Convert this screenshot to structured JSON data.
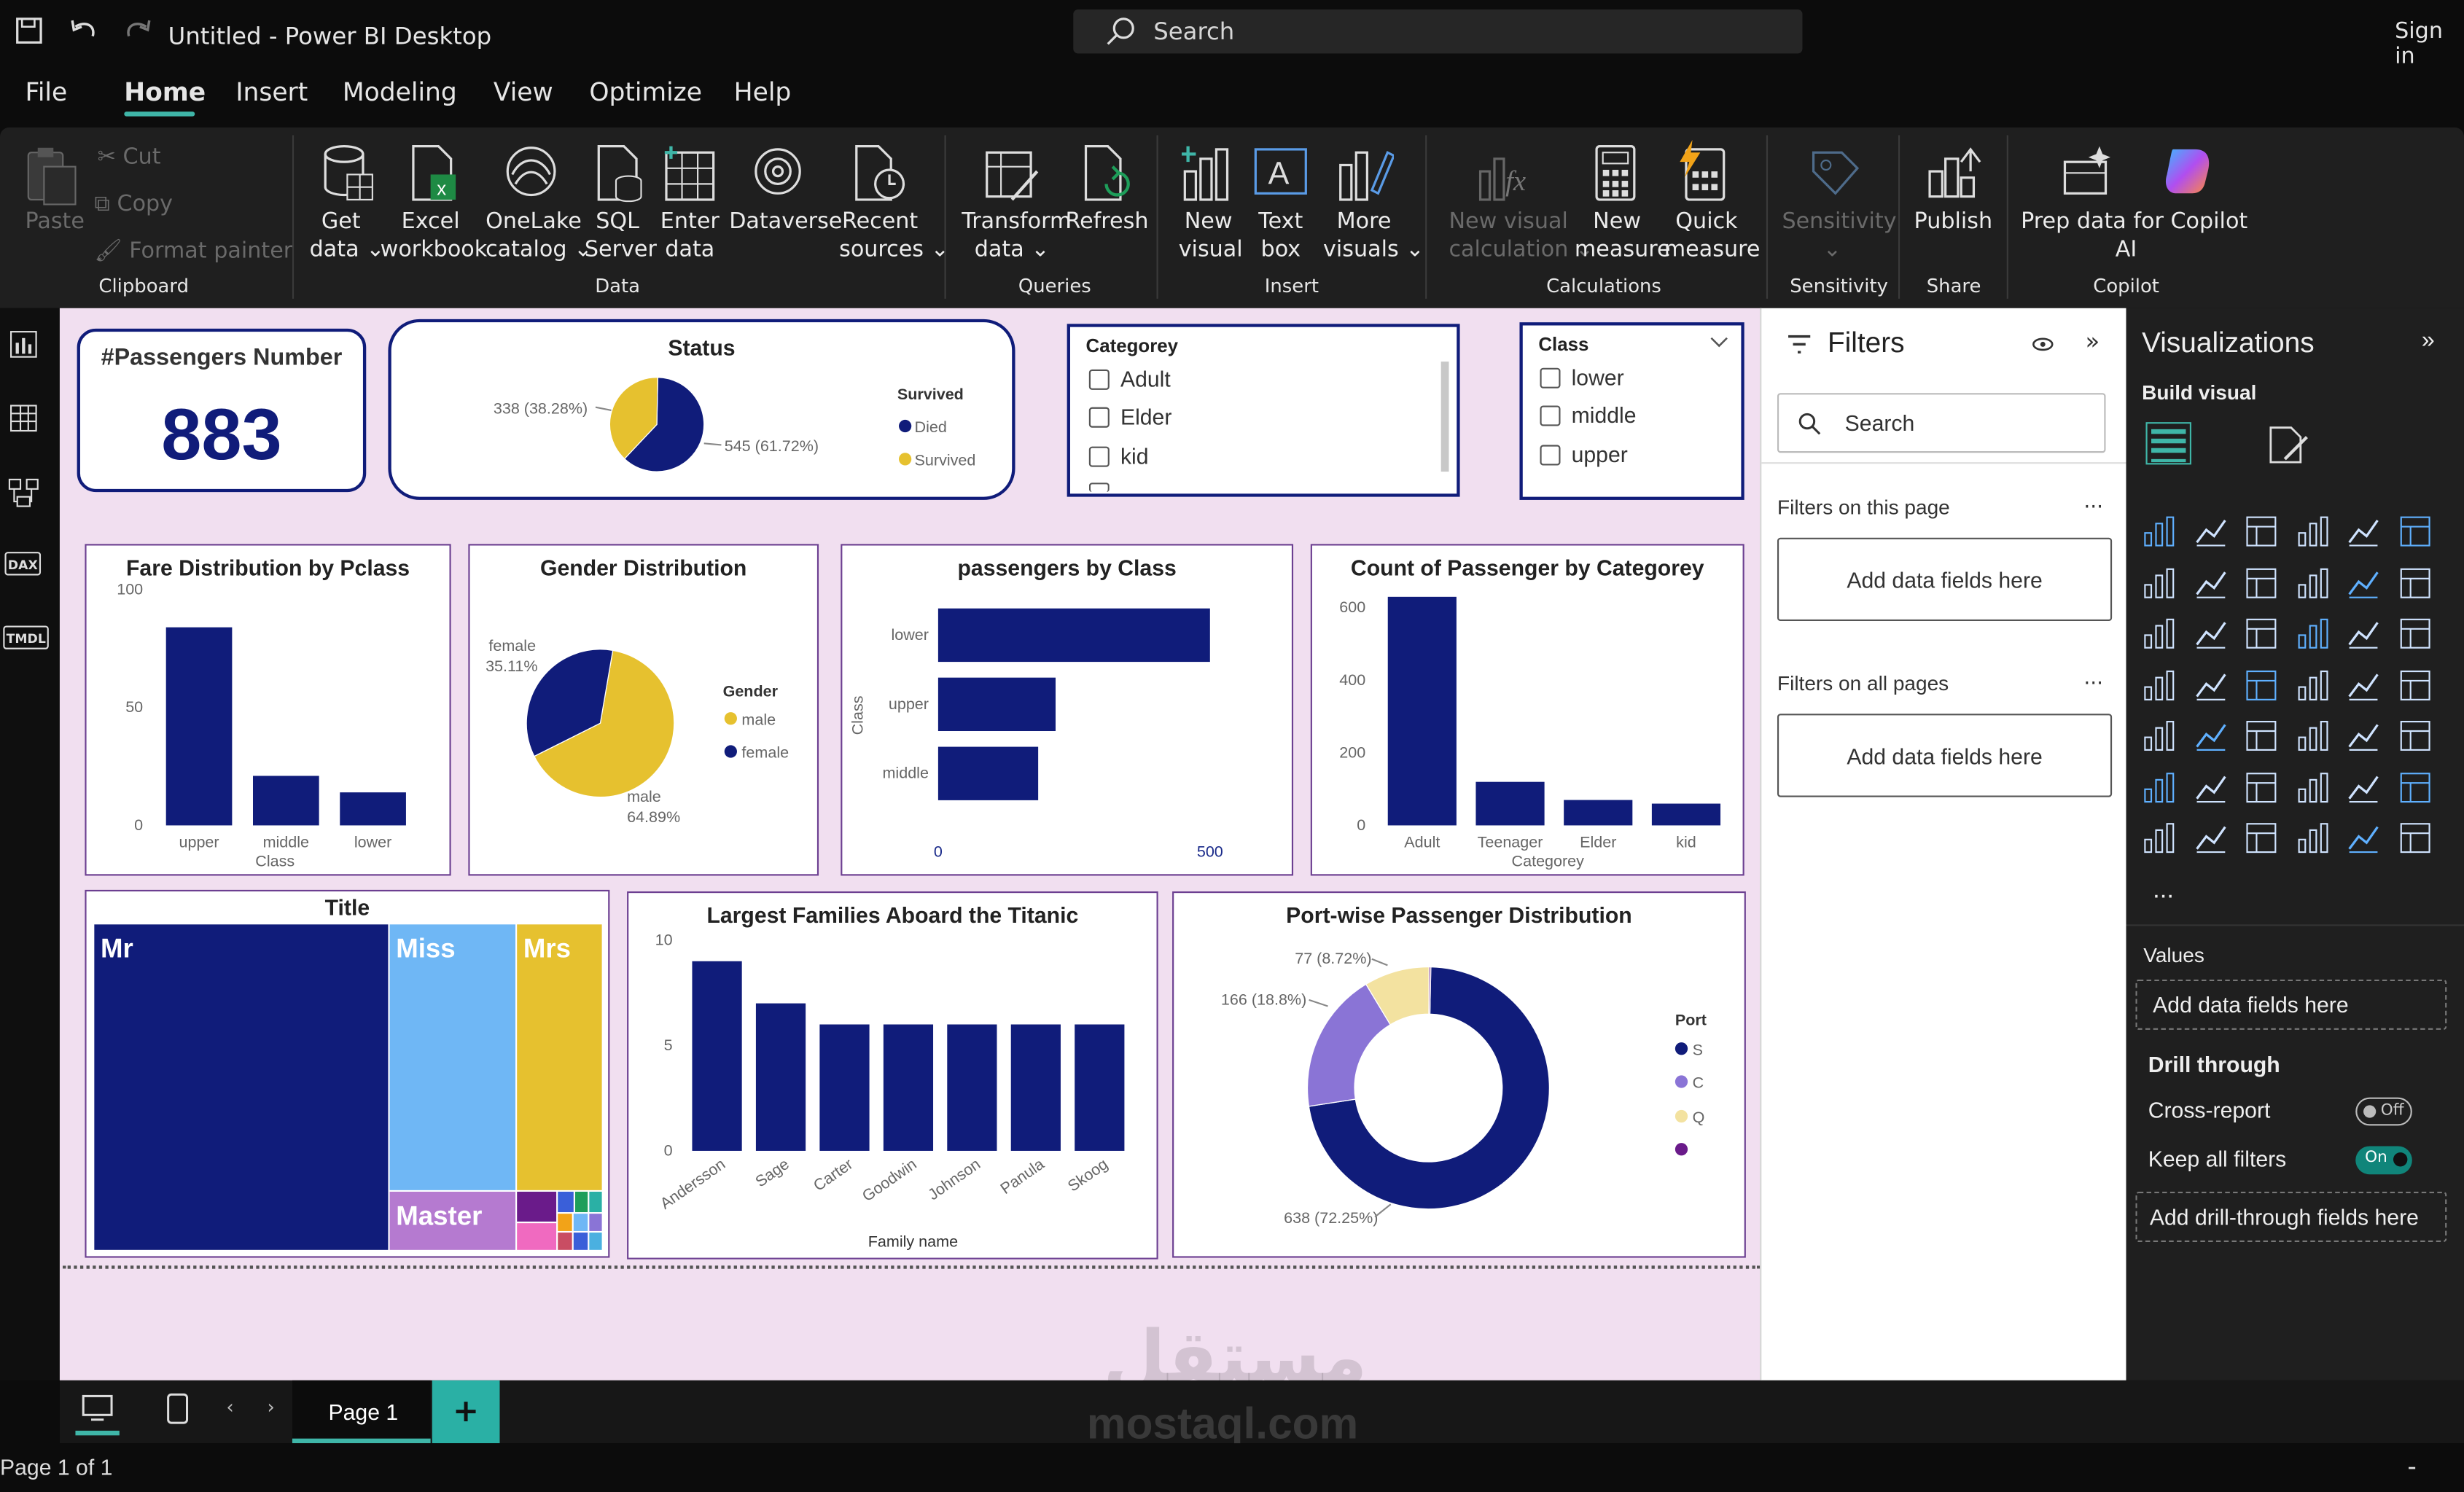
{
  "window": {
    "title": "Untitled - Power BI Desktop",
    "sign_in": "Sign in",
    "search_placeholder": "Search"
  },
  "menu_tabs": [
    "File",
    "Home",
    "Insert",
    "Modeling",
    "View",
    "Optimize",
    "Help"
  ],
  "ribbon": {
    "clipboard": {
      "paste": "Paste",
      "cut": "Cut",
      "copy": "Copy",
      "format_painter": "Format painter",
      "group": "Clipboard"
    },
    "data": {
      "get_data": [
        "Get",
        "data ⌄"
      ],
      "excel": [
        "Excel",
        "workbook"
      ],
      "onelake": [
        "OneLake",
        "catalog ⌄"
      ],
      "sql": [
        "SQL",
        "Server"
      ],
      "enter": [
        "Enter",
        "data"
      ],
      "dataverse": "Dataverse",
      "recent": [
        "Recent",
        "sources ⌄"
      ],
      "group": "Data"
    },
    "queries": {
      "transform": [
        "Transform",
        "data ⌄"
      ],
      "refresh": "Refresh",
      "group": "Queries"
    },
    "insert": {
      "new_visual": [
        "New",
        "visual"
      ],
      "text_box": [
        "Text",
        "box"
      ],
      "more_visuals": [
        "More",
        "visuals ⌄"
      ],
      "group": "Insert"
    },
    "calculations": {
      "new_visual_calc": [
        "New visual",
        "calculation ⌄"
      ],
      "new_measure": [
        "New",
        "measure"
      ],
      "quick_measure": [
        "Quick",
        "measure"
      ],
      "group": "Calculations"
    },
    "sensitivity": {
      "label": "Sensitivity",
      "caret": "⌄",
      "group": "Sensitivity"
    },
    "share": {
      "publish": "Publish",
      "group": "Share"
    },
    "copilot": {
      "prep": [
        "Prep data for Copilot",
        "AI"
      ],
      "group": "Copilot"
    }
  },
  "left_rail": [
    "report-view-icon",
    "table-view-icon",
    "model-view-icon",
    "DAX",
    "TMDL"
  ],
  "kpi": {
    "title": "#Passengers Number",
    "value": "883"
  },
  "status_chart": {
    "title": "Status",
    "legend_title": "Survived",
    "labels": [
      "Died",
      "Survived"
    ],
    "data_labels": [
      "545 (61.72%)",
      "338 (38.28%)"
    ]
  },
  "categorey_slicer": {
    "title": "Categorey",
    "items": [
      "Adult",
      "Elder",
      "kid"
    ]
  },
  "class_slicer": {
    "title": "Class",
    "items": [
      "lower",
      "middle",
      "upper"
    ]
  },
  "chart_data": [
    {
      "type": "bar",
      "title": "Fare Distribution by Pclass",
      "xlabel": "Class",
      "categories": [
        "upper",
        "middle",
        "lower"
      ],
      "values": [
        84,
        21,
        14
      ],
      "ylim": [
        0,
        100
      ],
      "yticks": [
        "0",
        "50",
        "100"
      ]
    },
    {
      "type": "pie",
      "title": "Gender Distribution",
      "legend_title": "Gender",
      "categories": [
        "male",
        "female"
      ],
      "values": [
        64.89,
        35.11
      ],
      "data_labels": [
        "male\n64.89%",
        "female\n35.11%"
      ]
    },
    {
      "type": "bar",
      "orientation": "horizontal",
      "title": "passengers by Class",
      "ylabel": "Class",
      "categories": [
        "lower",
        "upper",
        "middle"
      ],
      "values": [
        500,
        216,
        184
      ],
      "xlim": [
        0,
        500
      ],
      "xticks": [
        "0",
        "500"
      ]
    },
    {
      "type": "bar",
      "title": "Count of Passenger by Categorey",
      "xlabel": "Categorey",
      "categories": [
        "Adult",
        "Teenager",
        "Elder",
        "kid"
      ],
      "values": [
        630,
        120,
        70,
        60
      ],
      "ylim": [
        0,
        650
      ],
      "yticks": [
        "0",
        "200",
        "400",
        "600"
      ]
    },
    {
      "type": "treemap",
      "title": "Title",
      "categories": [
        "Mr",
        "Miss",
        "Mrs",
        "Master"
      ],
      "values": [
        517,
        182,
        125,
        40
      ]
    },
    {
      "type": "bar",
      "title": "Largest Families Aboard the Titanic",
      "xlabel": "Family name",
      "categories": [
        "Andersson",
        "Sage",
        "Carter",
        "Goodwin",
        "Johnson",
        "Panula",
        "Skoog"
      ],
      "values": [
        9,
        7,
        6,
        6,
        6,
        6,
        6
      ],
      "ylim": [
        0,
        10
      ],
      "yticks": [
        "0",
        "5",
        "10"
      ]
    },
    {
      "type": "donut",
      "title": "Port-wise Passenger Distribution",
      "legend_title": "Port",
      "categories": [
        "S",
        "C",
        "Q",
        ""
      ],
      "values": [
        638,
        166,
        77,
        2
      ],
      "data_labels": [
        "638 (72.25%)",
        "166 (18.8%)",
        "77 (8.72%)"
      ]
    }
  ],
  "filters_pane": {
    "title": "Filters",
    "search": "Search",
    "on_page": "Filters on this page",
    "on_all": "Filters on all pages",
    "add_fields": "Add data fields here",
    "more": "..."
  },
  "viz_pane": {
    "title": "Visualizations",
    "build": "Build visual",
    "values": "Values",
    "add_fields": "Add data fields here",
    "drill": "Drill through",
    "cross_report": "Cross-report",
    "cross_state": "Off",
    "keep_filters": "Keep all filters",
    "keep_state": "On",
    "add_drill": "Add drill-through fields here",
    "more": "..."
  },
  "page_tabs": {
    "page1": "Page 1",
    "add": "+"
  },
  "status": {
    "page_info": "Page 1 of 1",
    "minus": "-"
  },
  "watermark": {
    "arabic": "مستقل",
    "latin": "mostaql.com"
  },
  "colors": {
    "navy": "#101c7a",
    "yellow": "#e6c12f",
    "lightblue": "#6fb7f5",
    "purple": "#b57ad0",
    "canvas": "#f1dff0",
    "accent": "#3fb6a8"
  }
}
